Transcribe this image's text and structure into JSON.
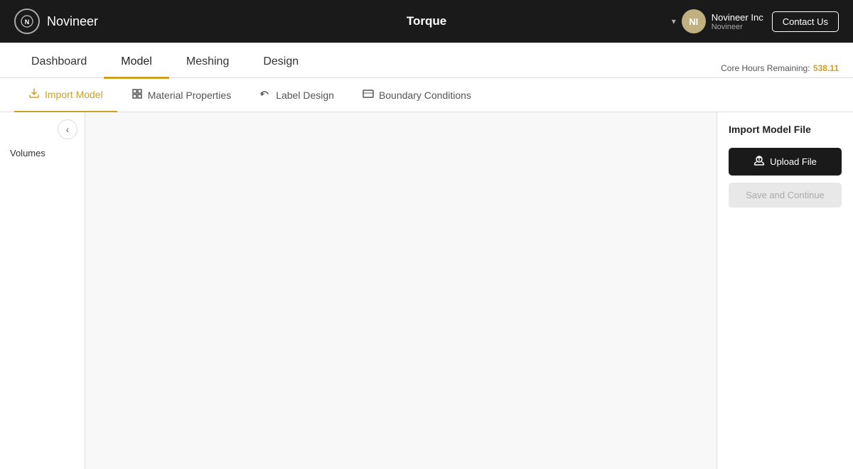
{
  "header": {
    "logo_text": "Novineer",
    "logo_initials": "N",
    "page_title": "Torque",
    "user": {
      "name": "Novineer Inc",
      "sub": "Novineer",
      "initials": "NI"
    },
    "contact_label": "Contact Us",
    "chevron": "▾"
  },
  "main_nav": {
    "tabs": [
      {
        "label": "Dashboard",
        "active": false
      },
      {
        "label": "Model",
        "active": true
      },
      {
        "label": "Meshing",
        "active": false
      },
      {
        "label": "Design",
        "active": false
      }
    ]
  },
  "sub_nav": {
    "tabs": [
      {
        "label": "Import Model",
        "active": true,
        "icon": "⬇"
      },
      {
        "label": "Material Properties",
        "active": false,
        "icon": "⬜"
      },
      {
        "label": "Label Design",
        "active": false,
        "icon": "↩"
      },
      {
        "label": "Boundary Conditions",
        "active": false,
        "icon": "⬜"
      }
    ]
  },
  "left_panel": {
    "collapse_icon": "‹",
    "volumes_label": "Volumes"
  },
  "right_panel": {
    "core_hours_label": "Core Hours Remaining:",
    "core_hours_value": "538.11",
    "import_title": "Import Model File",
    "upload_label": "Upload File",
    "save_label": "Save and Continue",
    "upload_icon": "☁"
  }
}
